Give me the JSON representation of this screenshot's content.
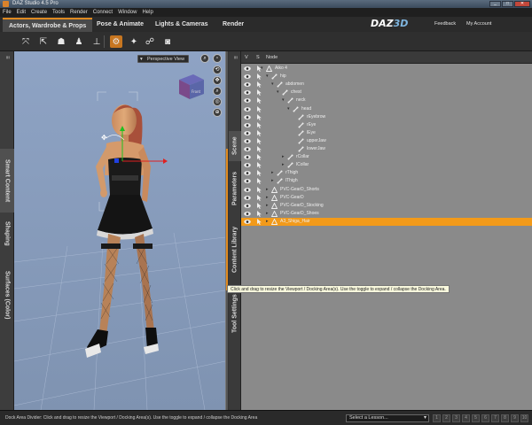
{
  "window": {
    "title": "DAZ Studio 4.5 Pro",
    "controls": [
      "_",
      "□",
      "✕"
    ]
  },
  "menu": [
    "File",
    "Edit",
    "Create",
    "Tools",
    "Render",
    "Connect",
    "Window",
    "Help"
  ],
  "tabs": [
    "Actors, Wardrobe & Props",
    "Pose & Animate",
    "Lights & Cameras",
    "Render"
  ],
  "brand": {
    "logo_main": "DAZ",
    "logo_accent": "3D",
    "links": [
      "Feedback",
      "My Account"
    ]
  },
  "left_tabs": [
    "Smart Content",
    "Shaping",
    "Surfaces (Color)"
  ],
  "viewport": {
    "view_label": "Perspective View"
  },
  "right_tabs": [
    "Scene",
    "Parameters",
    "Content Library",
    "Tool Settings"
  ],
  "scene": {
    "columns": [
      "V",
      "S",
      "Node"
    ],
    "rows": [
      {
        "label": "Aiko 4"
      },
      {
        "label": "hip"
      },
      {
        "label": "abdomen"
      },
      {
        "label": "chest"
      },
      {
        "label": "neck"
      },
      {
        "label": "head"
      },
      {
        "label": "rEyebrow"
      },
      {
        "label": "rEye"
      },
      {
        "label": "lEye"
      },
      {
        "label": "upperJaw"
      },
      {
        "label": "lowerJaw"
      },
      {
        "label": "rCollar"
      },
      {
        "label": "lCollar"
      },
      {
        "label": "rThigh"
      },
      {
        "label": "lThigh"
      },
      {
        "label": "PVC-GearD_Shorts"
      },
      {
        "label": "PVC-GearD"
      },
      {
        "label": "PVC-GearD_Stocking"
      },
      {
        "label": "PVC-GearD_Shoes"
      },
      {
        "label": "A3_Shiga_Hair"
      }
    ]
  },
  "tooltip": "Click and drag to resize the Viewport / Docking Area(s). Use the toggle to expand / collapse the Docking Area.",
  "status": {
    "message": "Dock Area Divider: Click and drag to resize the Viewport / Docking Area(s). Use the toggle to expand / collapse the Docking Area",
    "lesson_placeholder": "Select a Lesson...",
    "pages": [
      "1",
      "2",
      "3",
      "4",
      "5",
      "6",
      "7",
      "8",
      "9",
      "10"
    ]
  },
  "colors": {
    "accent": "#e08a20",
    "selection": "#f29a1a",
    "viewport_bg": "#8fa3c2",
    "scene_bg": "#8a8a8a"
  }
}
